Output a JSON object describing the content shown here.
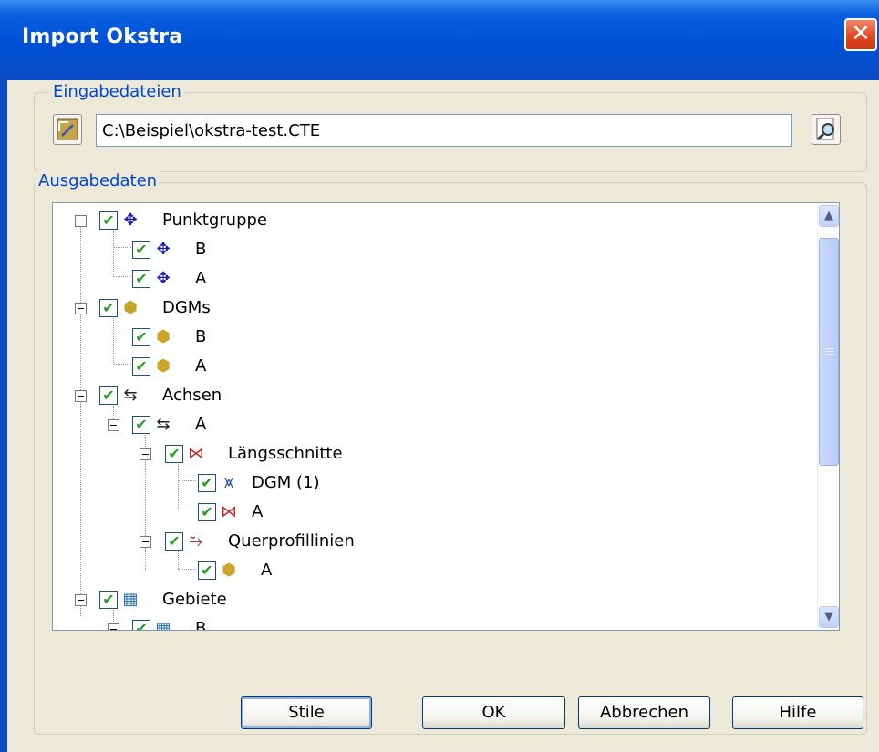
{
  "window": {
    "title": "Import Okstra",
    "close_glyph": "✕"
  },
  "input_group": {
    "legend": "Eingabedateien",
    "file_path": "C:\\Beispiel\\okstra-test.CTE"
  },
  "output_group": {
    "legend": "Ausgabedaten"
  },
  "tree": {
    "check_glyph": "✔",
    "nodes": [
      {
        "label": "Punktgruppe",
        "icon": "point-group-icon",
        "glyph": "✥"
      },
      {
        "label": "B",
        "icon": "point-group-icon",
        "glyph": "✥"
      },
      {
        "label": "A",
        "icon": "point-group-icon",
        "glyph": "✥"
      },
      {
        "label": "DGMs",
        "icon": "dgm-surface-icon",
        "glyph": "⬢"
      },
      {
        "label": "B",
        "icon": "dgm-surface-icon",
        "glyph": "⬢"
      },
      {
        "label": "A",
        "icon": "dgm-surface-icon",
        "glyph": "⬢"
      },
      {
        "label": "Achsen",
        "icon": "alignment-icon",
        "glyph": "⇆"
      },
      {
        "label": "A",
        "icon": "alignment-icon",
        "glyph": "⇆"
      },
      {
        "label": "Längsschnitte",
        "icon": "profile-icon",
        "glyph": "⋈"
      },
      {
        "label": "DGM (1)",
        "icon": "profile-line-icon",
        "glyph": "⩙"
      },
      {
        "label": "A",
        "icon": "profile-icon",
        "glyph": "⋈"
      },
      {
        "label": "Querprofillinien",
        "icon": "cross-section-icon",
        "glyph": "⥲"
      },
      {
        "label": "A",
        "icon": "cross-section-surface-icon",
        "glyph": "⬢"
      },
      {
        "label": "Gebiete",
        "icon": "site-map-icon",
        "glyph": "▦"
      },
      {
        "label": "B",
        "icon": "site-map-icon",
        "glyph": "▦"
      }
    ]
  },
  "scrollbar": {
    "up_glyph": "▲",
    "down_glyph": "▼"
  },
  "buttons": {
    "styles": "Stile",
    "ok": "OK",
    "cancel": "Abbrechen",
    "help": "Hilfe"
  },
  "colors": {
    "title_blue": "#0050d6",
    "legend_blue": "#0046d5",
    "check_green": "#21a121"
  }
}
